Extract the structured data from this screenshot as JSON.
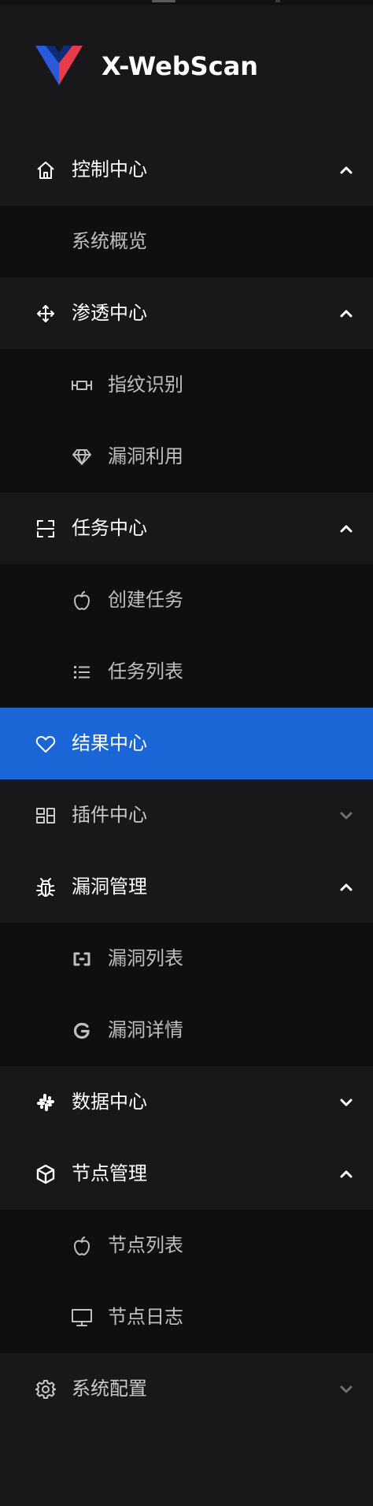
{
  "brand": {
    "name": "X-WebScan",
    "logo_colors": {
      "left": "#2a59d9",
      "right": "#e83b4a",
      "inner": "#0f2c7a"
    }
  },
  "colors": {
    "sidebar_bg": "#18181a",
    "submenu_bg": "#0f0f10",
    "active_bg": "#1a66d6",
    "text_primary": "#ffffff",
    "text_secondary": "#bfbfc3"
  },
  "menu": {
    "control_center": {
      "label": "控制中心",
      "icon": "home-icon",
      "expanded": true
    },
    "system_overview": {
      "label": "系统概览"
    },
    "penetration_center": {
      "label": "渗透中心",
      "icon": "move-arrows-icon",
      "expanded": true
    },
    "fingerprint": {
      "label": "指纹识别",
      "icon": "column-width-icon"
    },
    "vuln_exploit": {
      "label": "漏洞利用",
      "icon": "diamond-icon"
    },
    "task_center": {
      "label": "任务中心",
      "icon": "scan-frame-icon",
      "expanded": true
    },
    "create_task": {
      "label": "创建任务",
      "icon": "apple-icon"
    },
    "task_list": {
      "label": "任务列表",
      "icon": "list-icon"
    },
    "result_center": {
      "label": "结果中心",
      "icon": "heart-icon",
      "active": true
    },
    "plugin_center": {
      "label": "插件中心",
      "icon": "windows-grid-icon",
      "expanded": false
    },
    "vuln_management": {
      "label": "漏洞管理",
      "icon": "bug-icon",
      "expanded": true
    },
    "vuln_list": {
      "label": "漏洞列表",
      "icon": "brackets-icon"
    },
    "vuln_detail": {
      "label": "漏洞详情",
      "icon": "google-icon"
    },
    "data_center": {
      "label": "数据中心",
      "icon": "slack-icon",
      "expanded": false
    },
    "node_management": {
      "label": "节点管理",
      "icon": "cube-icon",
      "expanded": true
    },
    "node_list": {
      "label": "节点列表",
      "icon": "apple-icon"
    },
    "node_log": {
      "label": "节点日志",
      "icon": "desktop-icon"
    },
    "system_config": {
      "label": "系统配置",
      "icon": "gear-icon",
      "expanded": false
    }
  }
}
